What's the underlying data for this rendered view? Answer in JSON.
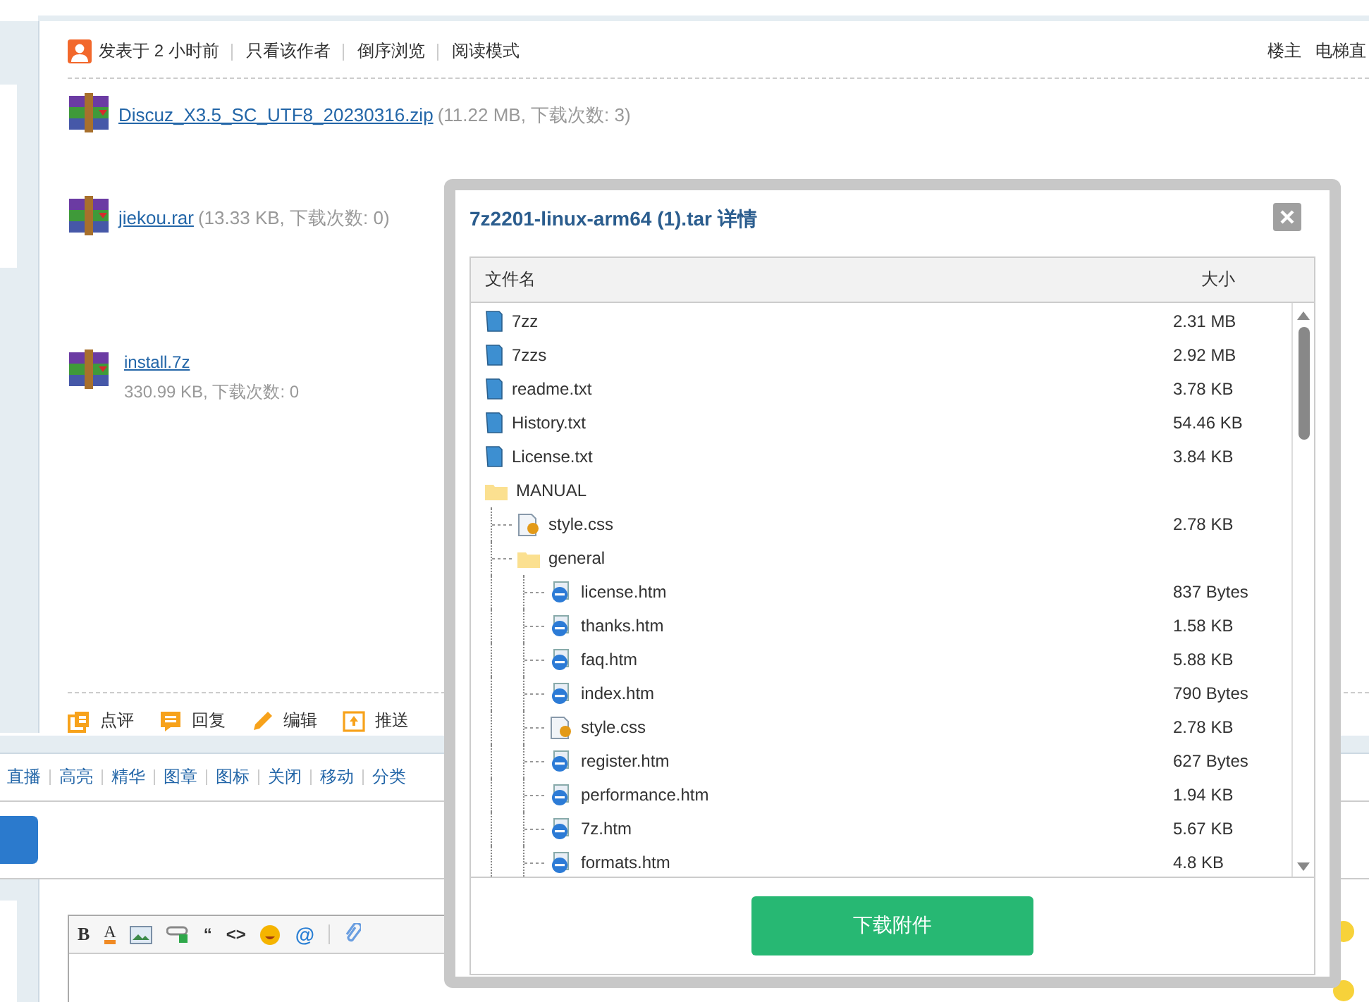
{
  "post": {
    "posted": "发表于 2 小时前",
    "links": [
      "只看该作者",
      "倒序浏览",
      "阅读模式"
    ],
    "floor": "楼主",
    "jump": "电梯直"
  },
  "attachments": [
    {
      "name": "Discuz_X3.5_SC_UTF8_20230316.zip",
      "info": "(11.22 MB, 下载次数: 3)",
      "kind": "inline"
    },
    {
      "name": "jiekou.rar",
      "info": "(13.33 KB, 下载次数: 0)",
      "kind": "inline"
    },
    {
      "name": "install.7z",
      "info": "330.99 KB, 下载次数: 0",
      "kind": "stacked"
    }
  ],
  "post_actions": [
    {
      "label": "点评",
      "kind": "rate"
    },
    {
      "label": "回复",
      "kind": "reply"
    },
    {
      "label": "编辑",
      "kind": "edit"
    },
    {
      "label": "推送",
      "kind": "push"
    }
  ],
  "moderation_links": [
    "直播",
    "高亮",
    "精华",
    "图章",
    "图标",
    "关闭",
    "移动",
    "分类"
  ],
  "editor_toolbar": [
    {
      "kind": "bold",
      "glyph": "B"
    },
    {
      "kind": "color",
      "glyph": "A"
    },
    {
      "kind": "image"
    },
    {
      "kind": "link"
    },
    {
      "kind": "quote",
      "glyph": "“"
    },
    {
      "kind": "code",
      "glyph": "<>"
    },
    {
      "kind": "smiley"
    },
    {
      "kind": "at",
      "glyph": "@"
    },
    {
      "kind": "attach"
    }
  ],
  "dialog": {
    "title": "7z2201-linux-arm64 (1).tar 详情",
    "columns": [
      "文件名",
      "大小"
    ],
    "files": [
      {
        "name": "7zz",
        "size": "2.31 MB",
        "kind": "file"
      },
      {
        "name": "7zzs",
        "size": "2.92 MB",
        "kind": "file"
      },
      {
        "name": "readme.txt",
        "size": "3.78 KB",
        "kind": "file"
      },
      {
        "name": "History.txt",
        "size": "54.46 KB",
        "kind": "file"
      },
      {
        "name": "License.txt",
        "size": "3.84 KB",
        "kind": "file"
      },
      {
        "name": "MANUAL",
        "kind": "folder",
        "children": [
          {
            "name": "style.css",
            "size": "2.78 KB",
            "kind": "css"
          },
          {
            "name": "general",
            "kind": "folder",
            "children": [
              {
                "name": "license.htm",
                "size": "837 Bytes",
                "kind": "htm"
              },
              {
                "name": "thanks.htm",
                "size": "1.58 KB",
                "kind": "htm"
              },
              {
                "name": "faq.htm",
                "size": "5.88 KB",
                "kind": "htm"
              },
              {
                "name": "index.htm",
                "size": "790 Bytes",
                "kind": "htm"
              },
              {
                "name": "style.css",
                "size": "2.78 KB",
                "kind": "css"
              },
              {
                "name": "register.htm",
                "size": "627 Bytes",
                "kind": "htm"
              },
              {
                "name": "performance.htm",
                "size": "1.94 KB",
                "kind": "htm"
              },
              {
                "name": "7z.htm",
                "size": "5.67 KB",
                "kind": "htm"
              },
              {
                "name": "formats.htm",
                "size": "4.8 KB",
                "kind": "htm"
              }
            ]
          }
        ]
      }
    ],
    "download_button": "下载附件"
  }
}
